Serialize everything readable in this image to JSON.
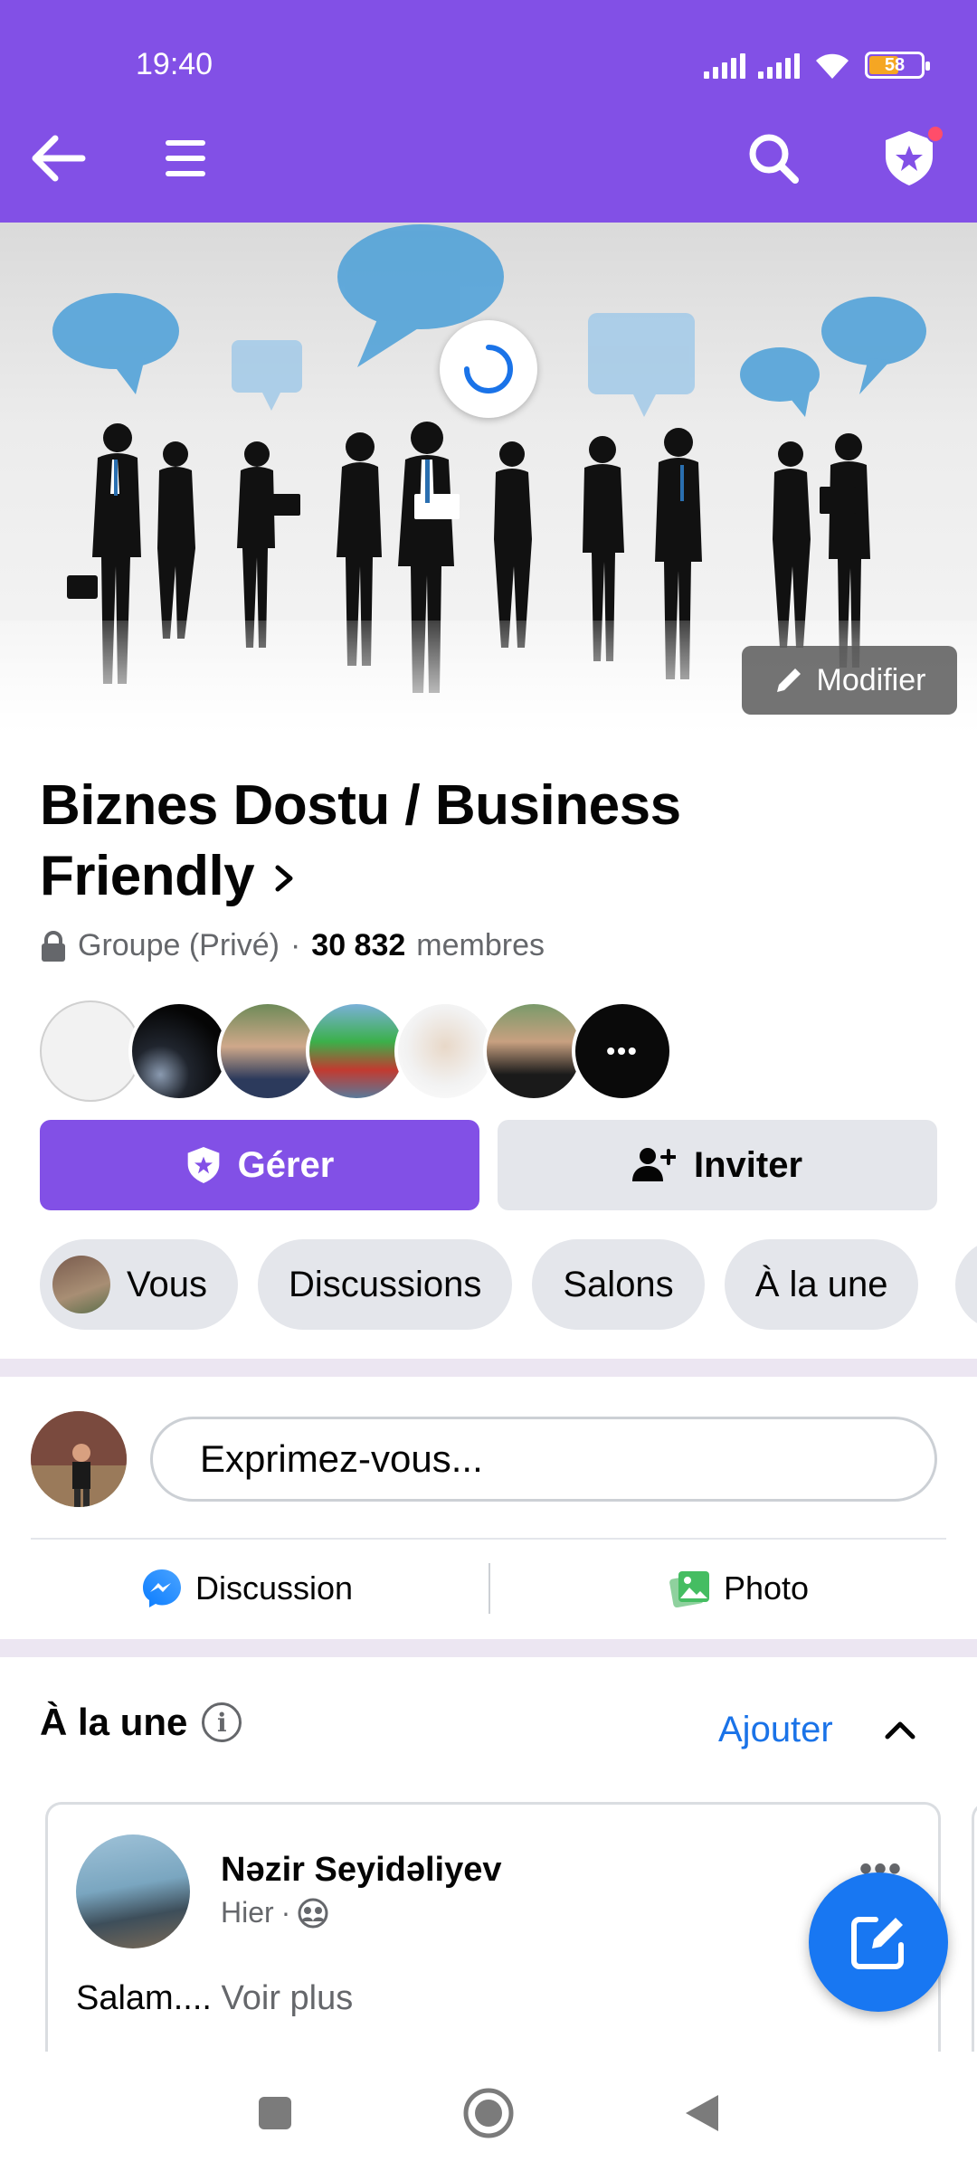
{
  "status_bar": {
    "time": "19:40",
    "battery": "58"
  },
  "header": {
    "back_icon": "arrow-left-icon",
    "menu_icon": "hamburger-icon",
    "search_icon": "search-icon",
    "admin_icon": "shield-star-icon",
    "accent_color": "#8250e6"
  },
  "cover": {
    "modify_label": "Modifier"
  },
  "group": {
    "title": "Biznes Dostu / Business Friendly",
    "privacy": "Groupe (Privé)",
    "separator": "·",
    "member_count": "30 832",
    "members_label": "membres",
    "more_avatars": "•••"
  },
  "buttons": {
    "manage": "Gérer",
    "invite": "Inviter"
  },
  "tabs": [
    {
      "label": "Vous"
    },
    {
      "label": "Discussions"
    },
    {
      "label": "Salons"
    },
    {
      "label": "À la une"
    }
  ],
  "composer": {
    "placeholder": "Exprimez-vous...",
    "discussion_label": "Discussion",
    "photo_label": "Photo"
  },
  "featured": {
    "title": "À la une",
    "info": "i",
    "add_label": "Ajouter",
    "post": {
      "author": "Nəzir Seyidəliyev",
      "time": "Hier",
      "time_separator": "·",
      "more": "•••",
      "text": "Salam....",
      "see_more": "Voir plus"
    }
  }
}
